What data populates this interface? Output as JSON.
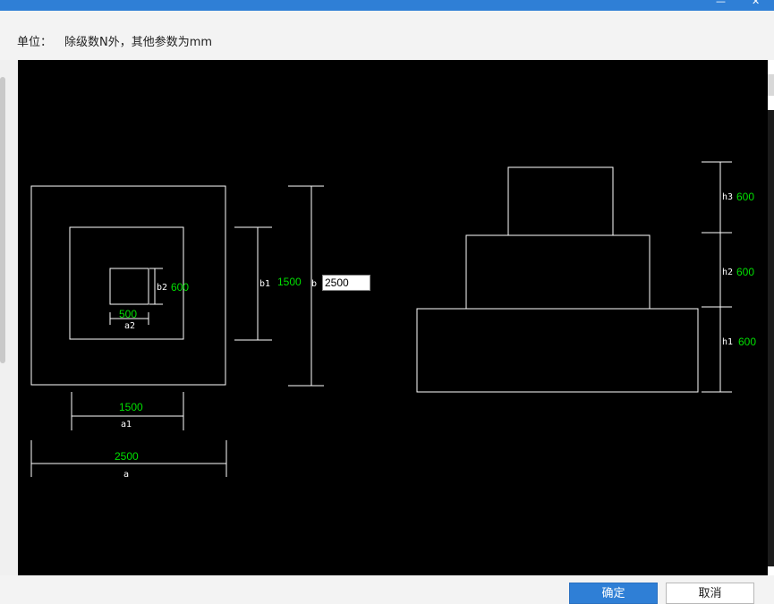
{
  "titlebar": {
    "minimize_glyph": "—",
    "close_glyph": "✕"
  },
  "unit": {
    "label": "单位：",
    "text": "除级数N外，其他参数为mm"
  },
  "plan": {
    "a2": {
      "name": "a2",
      "value": "500"
    },
    "b2": {
      "name": "b2",
      "value": "600"
    },
    "a1": {
      "name": "a1",
      "value": "1500"
    },
    "b1": {
      "name": "b1",
      "value": "1500"
    },
    "a": {
      "name": "a",
      "value": "2500"
    },
    "b": {
      "name": "b",
      "value": "2500"
    }
  },
  "section": {
    "h3": {
      "name": "h3",
      "value": "600"
    },
    "h2": {
      "name": "h2",
      "value": "600"
    },
    "h1": {
      "name": "h1",
      "value": "600"
    }
  },
  "buttons": {
    "ok": "确定",
    "cancel": "取消"
  },
  "colors": {
    "accent": "#2f7fd6",
    "canvas": "#000000",
    "dimension_value": "#00e000",
    "lines": "#ffffff"
  }
}
